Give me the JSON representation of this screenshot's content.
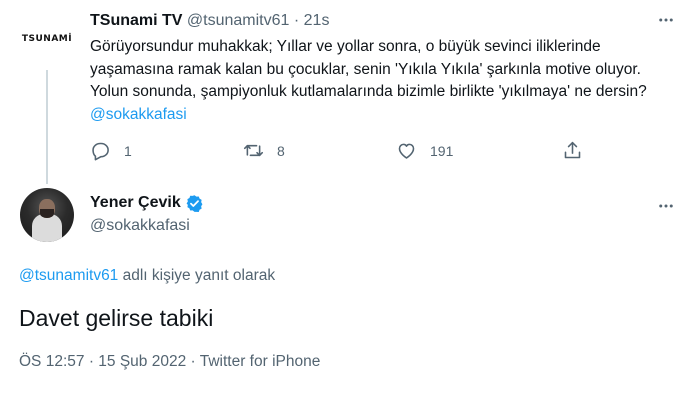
{
  "parent_tweet": {
    "avatar_text": "TSUNAMİ",
    "display_name": "TSunami TV",
    "handle": "@tsunamitv61",
    "separator": "·",
    "time": "21s",
    "text_before_mention": "Görüyorsundur muhakkak; Yıllar ve yollar sonra, o büyük sevinci iliklerinde yaşamasına ramak kalan bu çocuklar, senin 'Yıkıla Yıkıla' şarkınla motive oluyor. Yolun sonunda, şampiyonluk kutlamalarında bizimle birlikte 'yıkılmaya' ne dersin? ",
    "mention": "@sokakkafasi",
    "actions": {
      "reply_count": "1",
      "retweet_count": "8",
      "like_count": "191"
    },
    "icons": [
      "more-icon",
      "reply-icon",
      "retweet-icon",
      "like-icon",
      "share-icon"
    ]
  },
  "reply_tweet": {
    "display_name": "Yener Çevik",
    "handle": "@sokakkafasi",
    "verified": true,
    "reply_to_mention": "@tsunamitv61",
    "reply_to_suffix": " adlı kişiye yanıt olarak",
    "text": "Davet gelirse tabiki",
    "time": "ÖS 12:57",
    "date": "15 Şub 2022",
    "source": "Twitter for iPhone",
    "separator": "·"
  },
  "colors": {
    "accent": "#1d9bf0",
    "secondary_text": "#536471",
    "primary_text": "#0f1419",
    "thread_line": "#cfd9de"
  }
}
